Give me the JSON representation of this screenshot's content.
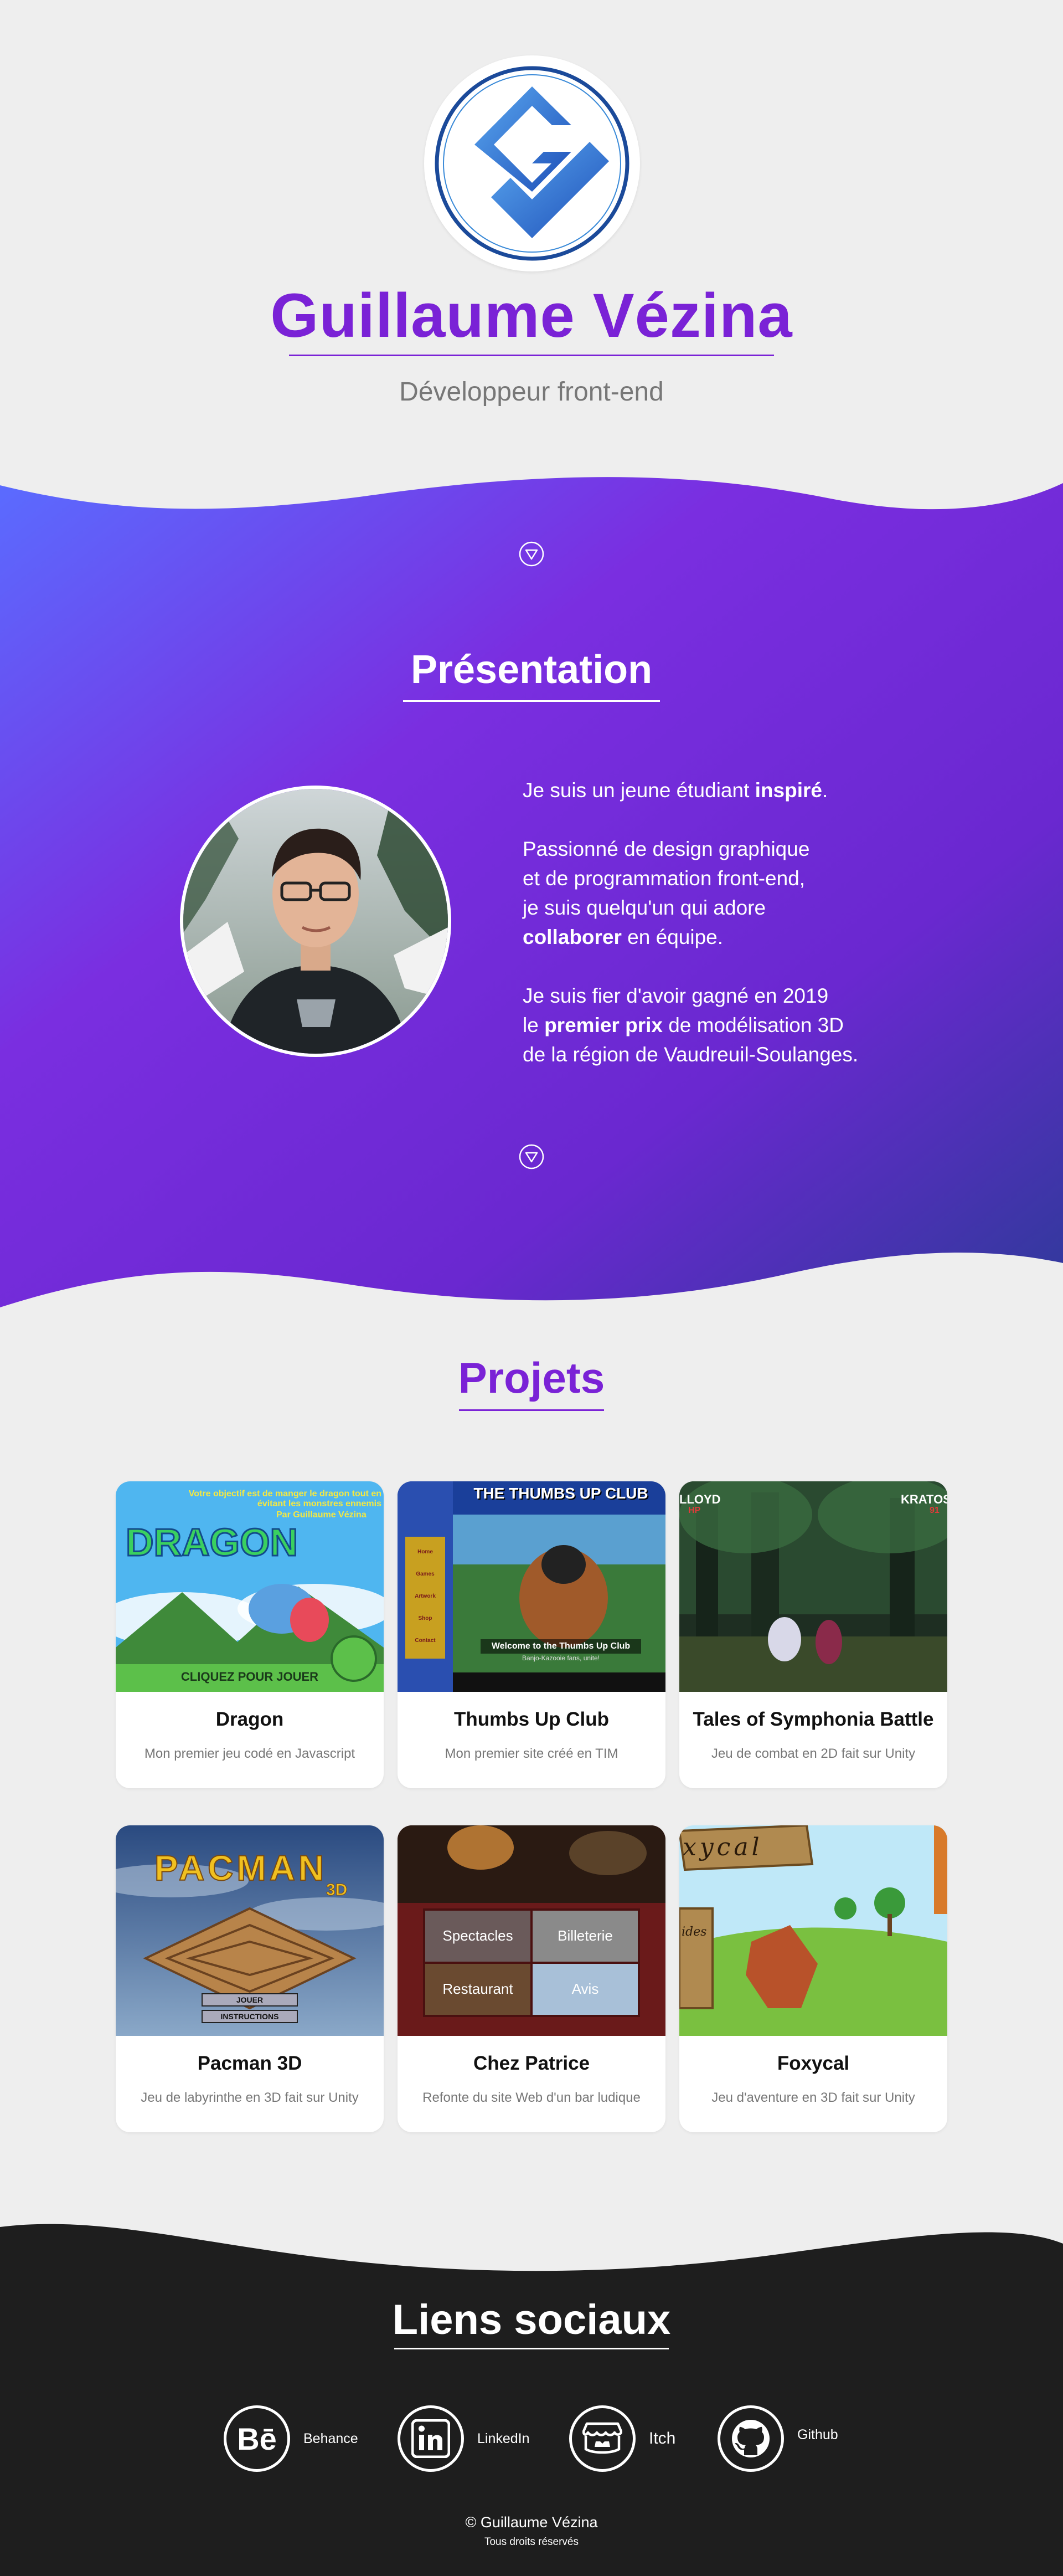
{
  "hero": {
    "name": "Guillaume Vézina",
    "role": "Développeur front-end"
  },
  "presentation": {
    "title": "Présentation",
    "p1_a": "Je suis un jeune étudiant ",
    "p1_b": "inspiré",
    "p1_c": ".",
    "p2_l1": "Passionné de design graphique",
    "p2_l2": "et de programmation front-end,",
    "p2_l3": "je suis quelqu'un qui adore",
    "p2_l4a": "collaborer",
    "p2_l4b": " en équipe.",
    "p3_l1": "Je suis fier d'avoir gagné en 2019",
    "p3_l2a": "le ",
    "p3_l2b": "premier prix",
    "p3_l2c": " de modélisation 3D",
    "p3_l3": "de la région de Vaudreuil-Soulanges."
  },
  "projects": {
    "title": "Projets",
    "items": [
      {
        "title": "Dragon",
        "desc": "Mon premier jeu codé en Javascript",
        "thumb": {
          "logo": "DRAGON",
          "banner": "Votre objectif est de manger le dragon tout en évitant les monstres ennemis",
          "author": "Par Guillaume Vézina",
          "button": "CLIQUEZ POUR JOUER"
        }
      },
      {
        "title": "Thumbs Up Club",
        "desc": "Mon premier site créé en TIM",
        "thumb": {
          "header": "THE THUMBS UP CLUB",
          "welcome": "Welcome to the Thumbs Up Club",
          "sub": "Banjo-Kazooie fans, unite!",
          "menu": [
            "Home",
            "Games",
            "Artwork",
            "Shop",
            "Contact"
          ]
        }
      },
      {
        "title": "Tales of Symphonia Battle",
        "desc": "Jeu de combat en 2D fait sur Unity",
        "thumb": {
          "left_name": "LLOYD",
          "left_hp": "HP",
          "right_name": "KRATOS",
          "right_hp": "91"
        }
      },
      {
        "title": "Pacman 3D",
        "desc": "Jeu de labyrinthe en 3D fait sur Unity",
        "thumb": {
          "logo": "PACMAN",
          "logo_sub": "3D",
          "btn1": "JOUER",
          "btn2": "INSTRUCTIONS"
        }
      },
      {
        "title": "Chez Patrice",
        "desc": "Refonte du site Web d'un bar ludique",
        "thumb": {
          "tiles": [
            "Spectacles",
            "Billeterie",
            "Restaurant",
            "Avis"
          ]
        }
      },
      {
        "title": "Foxycal",
        "desc": "Jeu d'aventure en 3D fait sur Unity",
        "thumb": {
          "sign": "xycal",
          "post": "ides"
        }
      }
    ]
  },
  "social": {
    "title": "Liens sociaux",
    "items": [
      {
        "label": "Behance",
        "icon": "behance-icon"
      },
      {
        "label": "LinkedIn",
        "icon": "linkedin-icon"
      },
      {
        "label": "Itch",
        "icon": "itch-icon"
      },
      {
        "label": "Github",
        "icon": "github-icon"
      }
    ],
    "copyright": "© Guillaume Vézina",
    "rights": "Tous droits réservés"
  },
  "colors": {
    "accent": "#7a22d6",
    "gradient_start": "#5a6cff",
    "gradient_end": "#2f3a9a",
    "footer": "#1e1e1e",
    "background": "#eeeeee"
  }
}
